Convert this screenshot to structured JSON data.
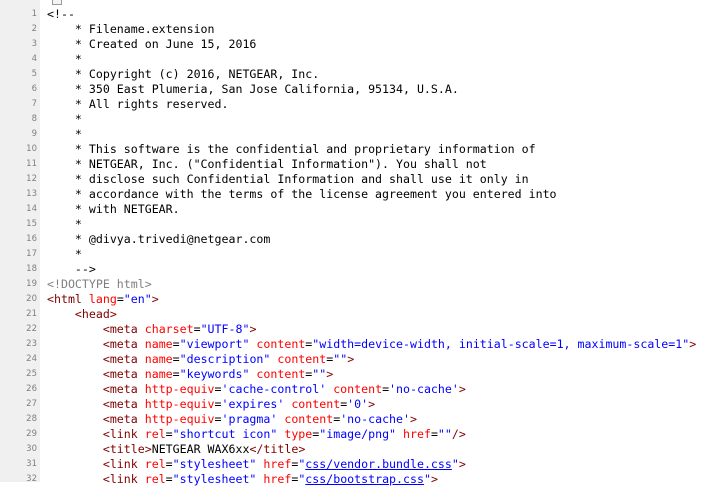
{
  "editor": {
    "lines": [
      {
        "n": "1",
        "segs": [
          {
            "t": "<!--",
            "c": "plain"
          }
        ]
      },
      {
        "n": "2",
        "segs": [
          {
            "t": "    * Filename.extension",
            "c": "plain"
          }
        ]
      },
      {
        "n": "3",
        "segs": [
          {
            "t": "    * Created on June 15, 2016",
            "c": "plain"
          }
        ]
      },
      {
        "n": "4",
        "segs": [
          {
            "t": "    *",
            "c": "plain"
          }
        ]
      },
      {
        "n": "5",
        "segs": [
          {
            "t": "    * Copyright (c) 2016, NETGEAR, Inc.",
            "c": "plain"
          }
        ]
      },
      {
        "n": "6",
        "segs": [
          {
            "t": "    * 350 East Plumeria, San Jose California, 95134, U.S.A.",
            "c": "plain"
          }
        ]
      },
      {
        "n": "7",
        "segs": [
          {
            "t": "    * All rights reserved.",
            "c": "plain"
          }
        ]
      },
      {
        "n": "8",
        "segs": [
          {
            "t": "    *",
            "c": "plain"
          }
        ]
      },
      {
        "n": "9",
        "segs": [
          {
            "t": "    *",
            "c": "plain"
          }
        ]
      },
      {
        "n": "10",
        "segs": [
          {
            "t": "    * This software is the confidential and proprietary information of",
            "c": "plain"
          }
        ]
      },
      {
        "n": "11",
        "segs": [
          {
            "t": "    * NETGEAR, Inc. (\"Confidential Information\"). You shall not",
            "c": "plain"
          }
        ]
      },
      {
        "n": "12",
        "segs": [
          {
            "t": "    * disclose such Confidential Information and shall use it only in",
            "c": "plain"
          }
        ]
      },
      {
        "n": "13",
        "segs": [
          {
            "t": "    * accordance with the terms of the license agreement you entered into",
            "c": "plain"
          }
        ]
      },
      {
        "n": "14",
        "segs": [
          {
            "t": "    * with NETGEAR.",
            "c": "plain"
          }
        ]
      },
      {
        "n": "15",
        "segs": [
          {
            "t": "    *",
            "c": "plain"
          }
        ]
      },
      {
        "n": "16",
        "segs": [
          {
            "t": "    * @divya.trivedi@netgear.com",
            "c": "plain"
          }
        ]
      },
      {
        "n": "17",
        "segs": [
          {
            "t": "    *",
            "c": "plain"
          }
        ]
      },
      {
        "n": "18",
        "segs": [
          {
            "t": "    -->",
            "c": "plain"
          }
        ]
      },
      {
        "n": "19",
        "segs": [
          {
            "t": "<!DOCTYPE html>",
            "c": "doctype"
          }
        ]
      },
      {
        "n": "20",
        "segs": [
          {
            "t": "<html",
            "c": "tag"
          },
          {
            "t": " lang",
            "c": "attr"
          },
          {
            "t": "=",
            "c": "plain"
          },
          {
            "t": "\"en\"",
            "c": "val"
          },
          {
            "t": ">",
            "c": "tag"
          }
        ]
      },
      {
        "n": "21",
        "segs": [
          {
            "t": "    ",
            "c": "plain"
          },
          {
            "t": "<head>",
            "c": "tag"
          }
        ]
      },
      {
        "n": "22",
        "segs": [
          {
            "t": "        ",
            "c": "plain"
          },
          {
            "t": "<meta",
            "c": "tag"
          },
          {
            "t": " charset",
            "c": "attr"
          },
          {
            "t": "=",
            "c": "plain"
          },
          {
            "t": "\"UTF-8\"",
            "c": "val"
          },
          {
            "t": ">",
            "c": "tag"
          }
        ]
      },
      {
        "n": "23",
        "segs": [
          {
            "t": "        ",
            "c": "plain"
          },
          {
            "t": "<meta",
            "c": "tag"
          },
          {
            "t": " name",
            "c": "attr"
          },
          {
            "t": "=",
            "c": "plain"
          },
          {
            "t": "\"viewport\"",
            "c": "val"
          },
          {
            "t": " content",
            "c": "attr"
          },
          {
            "t": "=",
            "c": "plain"
          },
          {
            "t": "\"width=device-width, initial-scale=1, maximum-scale=1\"",
            "c": "val"
          },
          {
            "t": ">",
            "c": "tag"
          }
        ]
      },
      {
        "n": "24",
        "segs": [
          {
            "t": "        ",
            "c": "plain"
          },
          {
            "t": "<meta",
            "c": "tag"
          },
          {
            "t": " name",
            "c": "attr"
          },
          {
            "t": "=",
            "c": "plain"
          },
          {
            "t": "\"description\"",
            "c": "val"
          },
          {
            "t": " content",
            "c": "attr"
          },
          {
            "t": "=",
            "c": "plain"
          },
          {
            "t": "\"\"",
            "c": "val"
          },
          {
            "t": ">",
            "c": "tag"
          }
        ]
      },
      {
        "n": "25",
        "segs": [
          {
            "t": "        ",
            "c": "plain"
          },
          {
            "t": "<meta",
            "c": "tag"
          },
          {
            "t": " name",
            "c": "attr"
          },
          {
            "t": "=",
            "c": "plain"
          },
          {
            "t": "\"keywords\"",
            "c": "val"
          },
          {
            "t": " content",
            "c": "attr"
          },
          {
            "t": "=",
            "c": "plain"
          },
          {
            "t": "\"\"",
            "c": "val"
          },
          {
            "t": ">",
            "c": "tag"
          }
        ]
      },
      {
        "n": "26",
        "segs": [
          {
            "t": "        ",
            "c": "plain"
          },
          {
            "t": "<meta",
            "c": "tag"
          },
          {
            "t": " http-equiv",
            "c": "attr"
          },
          {
            "t": "=",
            "c": "plain"
          },
          {
            "t": "'cache-control'",
            "c": "val"
          },
          {
            "t": " content",
            "c": "attr"
          },
          {
            "t": "=",
            "c": "plain"
          },
          {
            "t": "'no-cache'",
            "c": "val"
          },
          {
            "t": ">",
            "c": "tag"
          }
        ]
      },
      {
        "n": "27",
        "segs": [
          {
            "t": "        ",
            "c": "plain"
          },
          {
            "t": "<meta",
            "c": "tag"
          },
          {
            "t": " http-equiv",
            "c": "attr"
          },
          {
            "t": "=",
            "c": "plain"
          },
          {
            "t": "'expires'",
            "c": "val"
          },
          {
            "t": " content",
            "c": "attr"
          },
          {
            "t": "=",
            "c": "plain"
          },
          {
            "t": "'0'",
            "c": "val"
          },
          {
            "t": ">",
            "c": "tag"
          }
        ]
      },
      {
        "n": "28",
        "segs": [
          {
            "t": "        ",
            "c": "plain"
          },
          {
            "t": "<meta",
            "c": "tag"
          },
          {
            "t": " http-equiv",
            "c": "attr"
          },
          {
            "t": "=",
            "c": "plain"
          },
          {
            "t": "'pragma'",
            "c": "val"
          },
          {
            "t": " content",
            "c": "attr"
          },
          {
            "t": "=",
            "c": "plain"
          },
          {
            "t": "'no-cache'",
            "c": "val"
          },
          {
            "t": ">",
            "c": "tag"
          }
        ]
      },
      {
        "n": "29",
        "segs": [
          {
            "t": "        ",
            "c": "plain"
          },
          {
            "t": "<link",
            "c": "tag"
          },
          {
            "t": " rel",
            "c": "attr"
          },
          {
            "t": "=",
            "c": "plain"
          },
          {
            "t": "\"shortcut icon\"",
            "c": "val"
          },
          {
            "t": " type",
            "c": "attr"
          },
          {
            "t": "=",
            "c": "plain"
          },
          {
            "t": "\"image/png\"",
            "c": "val"
          },
          {
            "t": " href",
            "c": "attr"
          },
          {
            "t": "=",
            "c": "plain"
          },
          {
            "t": "\"\"",
            "c": "val"
          },
          {
            "t": "/>",
            "c": "tag"
          }
        ]
      },
      {
        "n": "30",
        "segs": [
          {
            "t": "        ",
            "c": "plain"
          },
          {
            "t": "<title>",
            "c": "tag"
          },
          {
            "t": "NETGEAR WAX6xx",
            "c": "plain"
          },
          {
            "t": "</title>",
            "c": "tag"
          }
        ]
      },
      {
        "n": "31",
        "segs": [
          {
            "t": "        ",
            "c": "plain"
          },
          {
            "t": "<link",
            "c": "tag"
          },
          {
            "t": " rel",
            "c": "attr"
          },
          {
            "t": "=",
            "c": "plain"
          },
          {
            "t": "\"stylesheet\"",
            "c": "val"
          },
          {
            "t": " href",
            "c": "attr"
          },
          {
            "t": "=",
            "c": "plain"
          },
          {
            "t": "\"",
            "c": "val"
          },
          {
            "t": "css/vendor.bundle.css",
            "c": "link"
          },
          {
            "t": "\"",
            "c": "val"
          },
          {
            "t": ">",
            "c": "tag"
          }
        ]
      },
      {
        "n": "32",
        "segs": [
          {
            "t": "        ",
            "c": "plain"
          },
          {
            "t": "<link",
            "c": "tag"
          },
          {
            "t": " rel",
            "c": "attr"
          },
          {
            "t": "=",
            "c": "plain"
          },
          {
            "t": "\"stylesheet\"",
            "c": "val"
          },
          {
            "t": " href",
            "c": "attr"
          },
          {
            "t": "=",
            "c": "plain"
          },
          {
            "t": "\"",
            "c": "val"
          },
          {
            "t": "css/bootstrap.css",
            "c": "link"
          },
          {
            "t": "\"",
            "c": "val"
          },
          {
            "t": ">",
            "c": "tag"
          }
        ]
      }
    ]
  }
}
